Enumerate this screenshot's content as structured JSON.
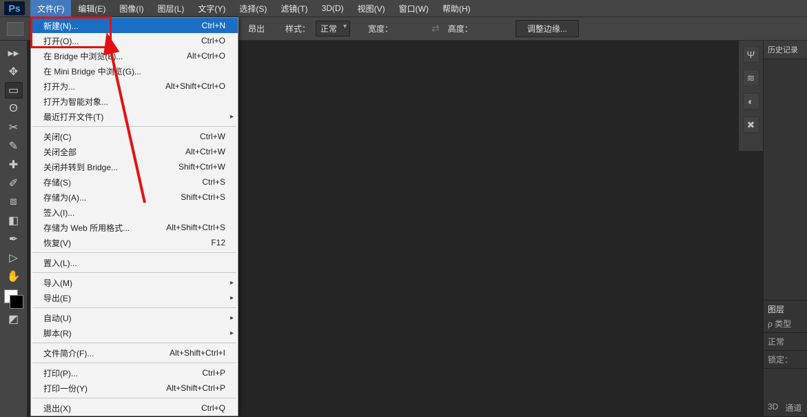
{
  "logo": "Ps",
  "menubar": {
    "file": "文件(F)",
    "edit": "编辑(E)",
    "image": "图像(I)",
    "layer": "图层(L)",
    "text": "文字(Y)",
    "select": "选择(S)",
    "filter": "滤镜(T)",
    "three_d": "3D(D)",
    "view": "视图(V)",
    "window": "窗口(W)",
    "help": "帮助(H)"
  },
  "optionbar": {
    "hidden_label": "昂出",
    "style_label": "样式：",
    "style_value": "正常",
    "width_label": "宽度：",
    "height_label": "高度：",
    "refine_btn": "调整边缘..."
  },
  "dropdown": {
    "new_label": "新建(N)...",
    "new_sc": "Ctrl+N",
    "open_label": "打开(O)...",
    "open_sc": "Ctrl+O",
    "bridge_label": "在 Bridge 中浏览(B)...",
    "bridge_sc": "Alt+Ctrl+O",
    "minibridge_label": "在 Mini Bridge 中浏览(G)...",
    "open_as_label": "打开为...",
    "open_as_sc": "Alt+Shift+Ctrl+O",
    "open_smart_label": "打开为智能对象...",
    "recent_label": "最近打开文件(T)",
    "close_label": "关闭(C)",
    "close_sc": "Ctrl+W",
    "close_all_label": "关闭全部",
    "close_all_sc": "Alt+Ctrl+W",
    "close_bridge_label": "关闭并转到 Bridge...",
    "close_bridge_sc": "Shift+Ctrl+W",
    "save_label": "存储(S)",
    "save_sc": "Ctrl+S",
    "save_as_label": "存储为(A)...",
    "save_as_sc": "Shift+Ctrl+S",
    "checkin_label": "签入(I)...",
    "save_web_label": "存储为 Web 所用格式...",
    "save_web_sc": "Alt+Shift+Ctrl+S",
    "revert_label": "恢复(V)",
    "revert_sc": "F12",
    "place_label": "置入(L)...",
    "import_label": "导入(M)",
    "export_label": "导出(E)",
    "automate_label": "自动(U)",
    "scripts_label": "脚本(R)",
    "fileinfo_label": "文件简介(F)...",
    "fileinfo_sc": "Alt+Shift+Ctrl+I",
    "print_label": "打印(P)...",
    "print_sc": "Ctrl+P",
    "print_one_label": "打印一份(Y)",
    "print_one_sc": "Alt+Shift+Ctrl+P",
    "exit_label": "退出(X)",
    "exit_sc": "Ctrl+Q"
  },
  "right": {
    "history_tab": "历史记录",
    "layers_tab": "图层",
    "kind_label": "ρ 类型",
    "blend": "正常",
    "lock_label": "锁定：",
    "three_d_tab": "3D",
    "channels_tab": "通道"
  }
}
